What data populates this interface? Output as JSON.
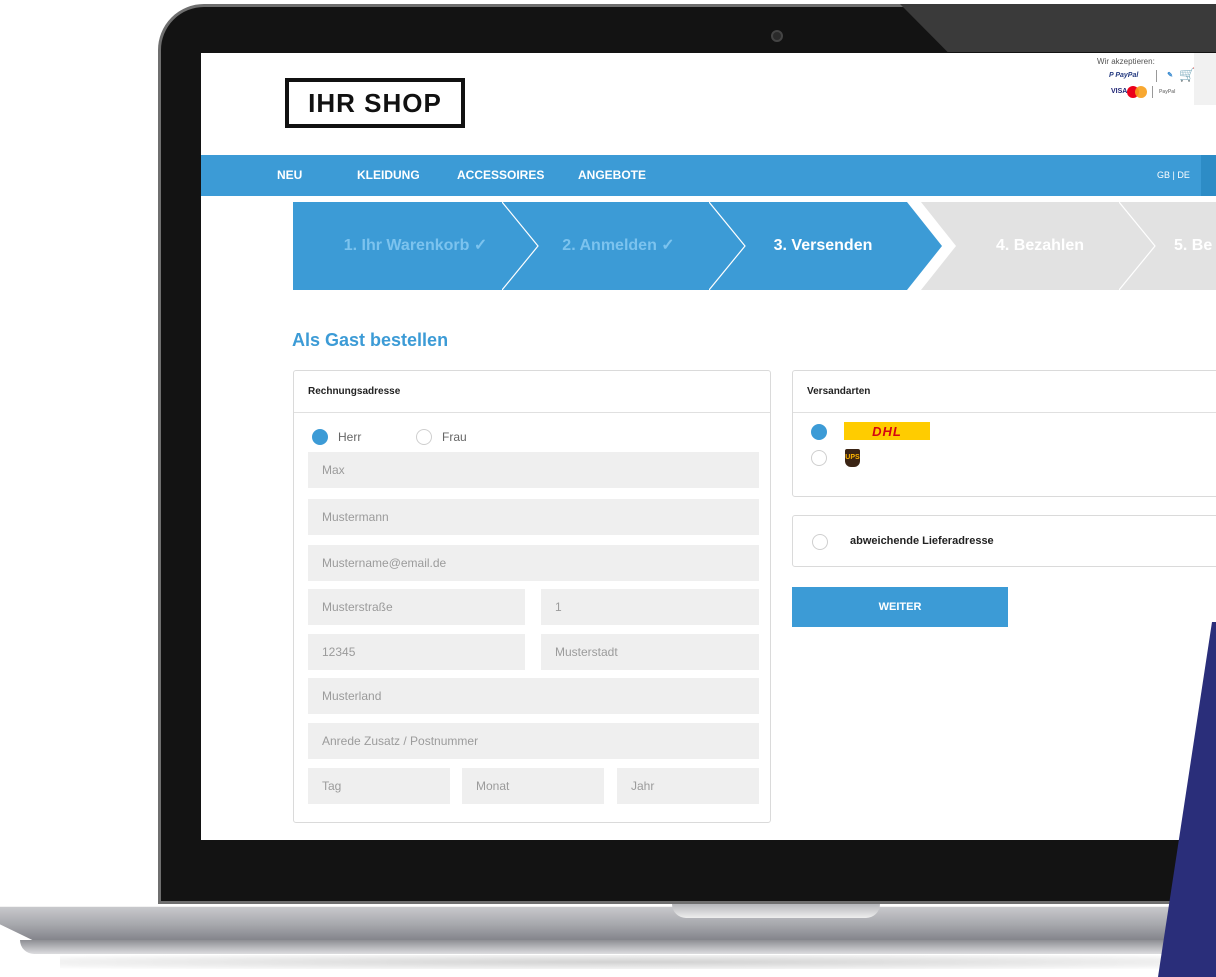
{
  "header": {
    "logo_text": "IHR SHOP",
    "accept_label": "Wir akzeptieren:",
    "payments": {
      "paypal": "P PayPal",
      "visa": "VISA",
      "other": "PayPal"
    }
  },
  "nav": {
    "items": [
      "NEU",
      "KLEIDUNG",
      "ACCESSOIRES",
      "ANGEBOTE"
    ],
    "language": "GB | DE"
  },
  "steps": [
    {
      "label": "1. Ihr Warenkorb ✓",
      "state": "done"
    },
    {
      "label": "2. Anmelden ✓",
      "state": "done"
    },
    {
      "label": "3. Versenden",
      "state": "active"
    },
    {
      "label": "4. Bezahlen",
      "state": "pending"
    },
    {
      "label": "5. Be",
      "state": "pending"
    }
  ],
  "page_title": "Als Gast bestellen",
  "billing": {
    "title": "Rechnungsadresse",
    "salutation_options": [
      "Herr",
      "Frau"
    ],
    "selected_salutation": "Herr",
    "fields": {
      "firstname": "Max",
      "lastname": "Mustermann",
      "email": "Mustername@email.de",
      "street": "Musterstraße",
      "house_number": "1",
      "zip": "12345",
      "city": "Musterstadt",
      "country": "Musterland",
      "address_extra": "Anrede Zusatz / Postnummer",
      "day": "Tag",
      "month": "Monat",
      "year": "Jahr"
    }
  },
  "shipping": {
    "title": "Versandarten",
    "carriers": [
      "DHL",
      "UPS"
    ],
    "selected_carrier": "DHL",
    "alt_address_label": "abweichende Lieferadresse",
    "continue_label": "WEITER"
  },
  "colors": {
    "accent": "#3c9bd6",
    "inactive_step": "#e2e2e2",
    "field_bg": "#efefef",
    "foreground_shape": "#2a2e7a"
  }
}
